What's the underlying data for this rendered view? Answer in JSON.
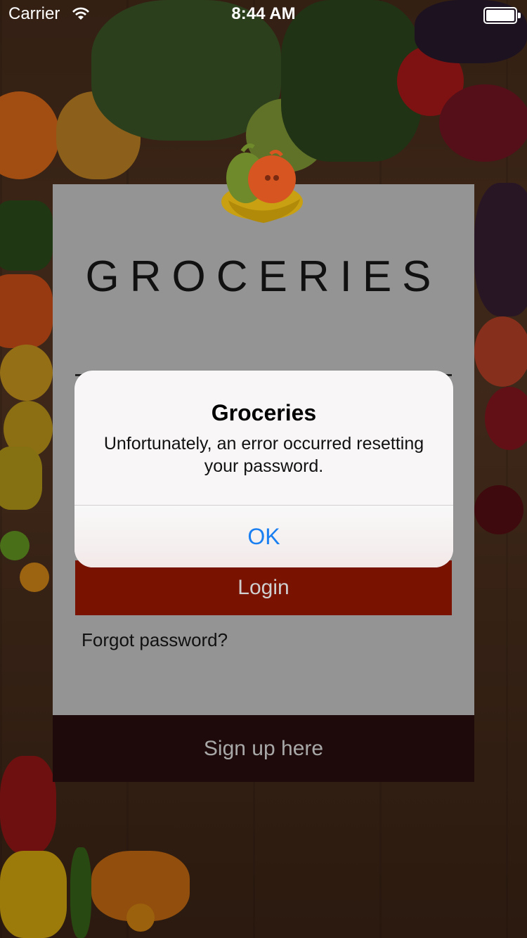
{
  "status_bar": {
    "carrier": "Carrier",
    "time": "8:44 AM"
  },
  "login_screen": {
    "app_title": "GROCERIES",
    "login_label": "Login",
    "forgot_label": "Forgot password?",
    "signup_label": "Sign up here"
  },
  "alert": {
    "title": "Groceries",
    "message": "Unfortunately, an error occurred resetting your password.",
    "ok_label": "OK"
  },
  "colors": {
    "login_button": "#7a1200",
    "signup_bar": "#1e0a0a",
    "card": "#949494",
    "ok_text": "#1a7ff0"
  }
}
